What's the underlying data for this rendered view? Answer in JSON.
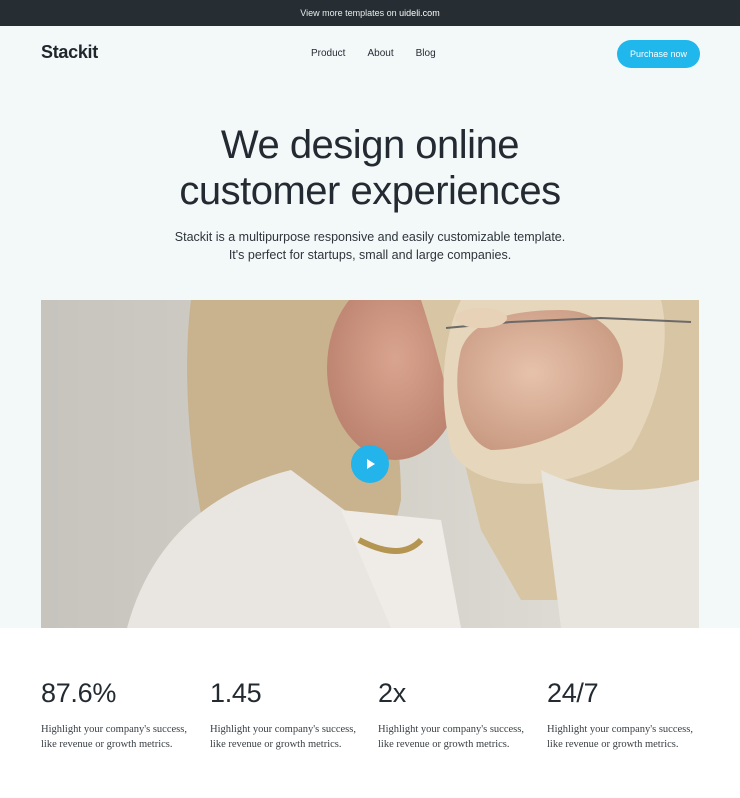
{
  "topbar": {
    "prefix": "View more templates on ",
    "link": "uideli.com"
  },
  "nav": {
    "logo": "Stackit",
    "items": [
      "Product",
      "About",
      "Blog"
    ],
    "cta": "Purchase now"
  },
  "hero": {
    "title_line1": "We design online",
    "title_line2": "customer experiences",
    "subtitle_line1": "Stackit is a multipurpose responsive and easily customizable template.",
    "subtitle_line2": "It's perfect for startups, small and large companies."
  },
  "media": {
    "icon": "play-icon",
    "accent": "#22b4ea"
  },
  "stats": [
    {
      "value": "87.6%",
      "line1": "Highlight your company's success,",
      "line2": "like revenue or growth metrics."
    },
    {
      "value": "1.45",
      "line1": "Highlight your company's success,",
      "line2": "like revenue or growth metrics."
    },
    {
      "value": "2x",
      "line1": "Highlight your company's success,",
      "line2": "like revenue or growth metrics."
    },
    {
      "value": "24/7",
      "line1": "Highlight your company's success,",
      "line2": "like revenue or growth metrics."
    }
  ],
  "colors": {
    "accent": "#1fb7ec",
    "topbar": "#262e33",
    "background": "#f3f8f9"
  }
}
